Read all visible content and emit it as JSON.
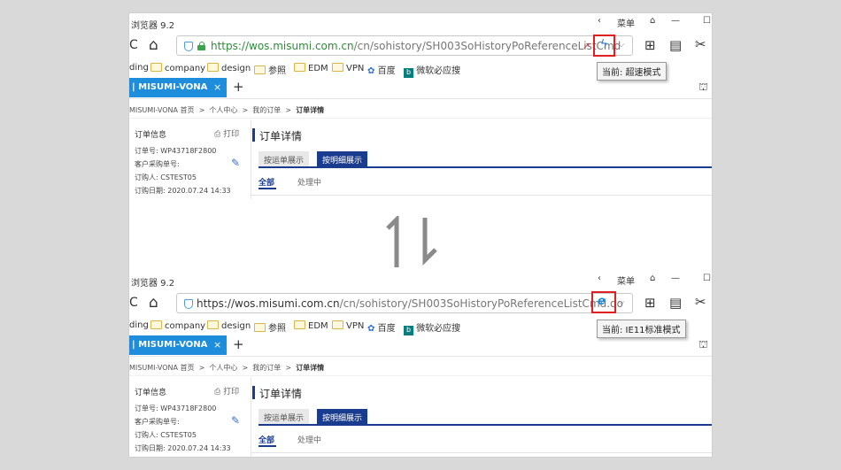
{
  "top": {
    "window_title": "浏览器 9.2",
    "menu_label": "菜单",
    "url_host": "https://wos.misumi.com.cn",
    "url_path": "/cn/sohistory/SH003SoHistoryPoReferenceListCmd",
    "tooltip": "当前: 超速模式",
    "mode_icon": "lightning-icon",
    "secure": true
  },
  "bottom": {
    "window_title": "浏览器 9.2",
    "menu_label": "菜单",
    "url_host": "https://wos.misumi.com.cn",
    "url_path": "/cn/sohistory/SH003SoHistoryPoReferenceListCmd.do",
    "tooltip": "当前: IE11标准模式",
    "mode_icon": "ie-icon",
    "secure": false
  },
  "bookmarks": [
    "ding",
    "company",
    "design",
    "参照",
    "EDM",
    "VPN",
    "百度",
    "微软必应搜"
  ],
  "tab_label": "| MISUMI-VONA",
  "tab_close": "×",
  "new_tab": "+",
  "breadcrumb": {
    "home": "MISUMI-VONA 首页",
    "sep": ">",
    "center": "个人中心",
    "orders": "我的订单",
    "current": "订单详情"
  },
  "order_info": {
    "title": "订单信息",
    "print": "打印",
    "order_no": "订单号: WP43718F2800",
    "customer_po": "客户采购单号:",
    "buyer": "订购人: CSTEST05",
    "date": "订购日期: 2020.07.24 14:33"
  },
  "detail": {
    "heading": "订单详情",
    "tab_shipment": "按运单展示",
    "tab_detail": "按明细展示",
    "filter_all": "全部",
    "filter_processing": "处理中"
  },
  "colors": {
    "accent_navy": "#1a3c8f",
    "tab_blue": "#1d8ddc",
    "highlight_red": "#e02020"
  }
}
